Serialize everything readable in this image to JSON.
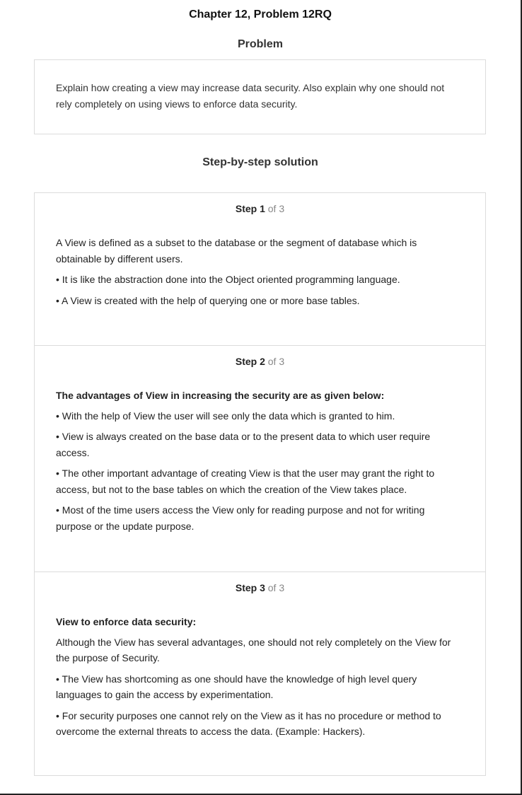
{
  "chapter_title": "Chapter 12, Problem 12RQ",
  "problem_heading": "Problem",
  "problem_text": "Explain how creating a view may increase data security. Also explain why one should not rely completely on using views to enforce data security.",
  "solution_heading": "Step-by-step solution",
  "steps": [
    {
      "label": "Step 1",
      "of": "of 3",
      "paragraphs": [
        "A View is defined as a subset to the database or the segment of database which is obtainable by different users.",
        "• It is like the abstraction done into the Object oriented programming language.",
        "• A View is created with the help of querying one or more base tables."
      ]
    },
    {
      "label": "Step 2",
      "of": "of 3",
      "heading": "The advantages of View in increasing the security are as given below:",
      "paragraphs": [
        "• With the help of View the user will see only the data which is granted to him.",
        "• View is always created on the base data or to the present data to which user require access.",
        "• The other important advantage of creating View is that the user may grant the right to access, but not to the base tables on which the creation of the View takes place.",
        "• Most of the time users access the View only for reading purpose and not for writing purpose or the update purpose."
      ]
    },
    {
      "label": "Step 3",
      "of": "of 3",
      "heading": "View to enforce data security:",
      "paragraphs": [
        "Although the View has several advantages, one should not rely completely on the View for the purpose of Security.",
        "• The View has shortcoming as one should have the knowledge of high level query languages to gain the access by experimentation.",
        "• For security purposes one cannot rely on the View as it has no procedure or method to overcome the external threats to access the data. (Example: Hackers)."
      ]
    }
  ]
}
